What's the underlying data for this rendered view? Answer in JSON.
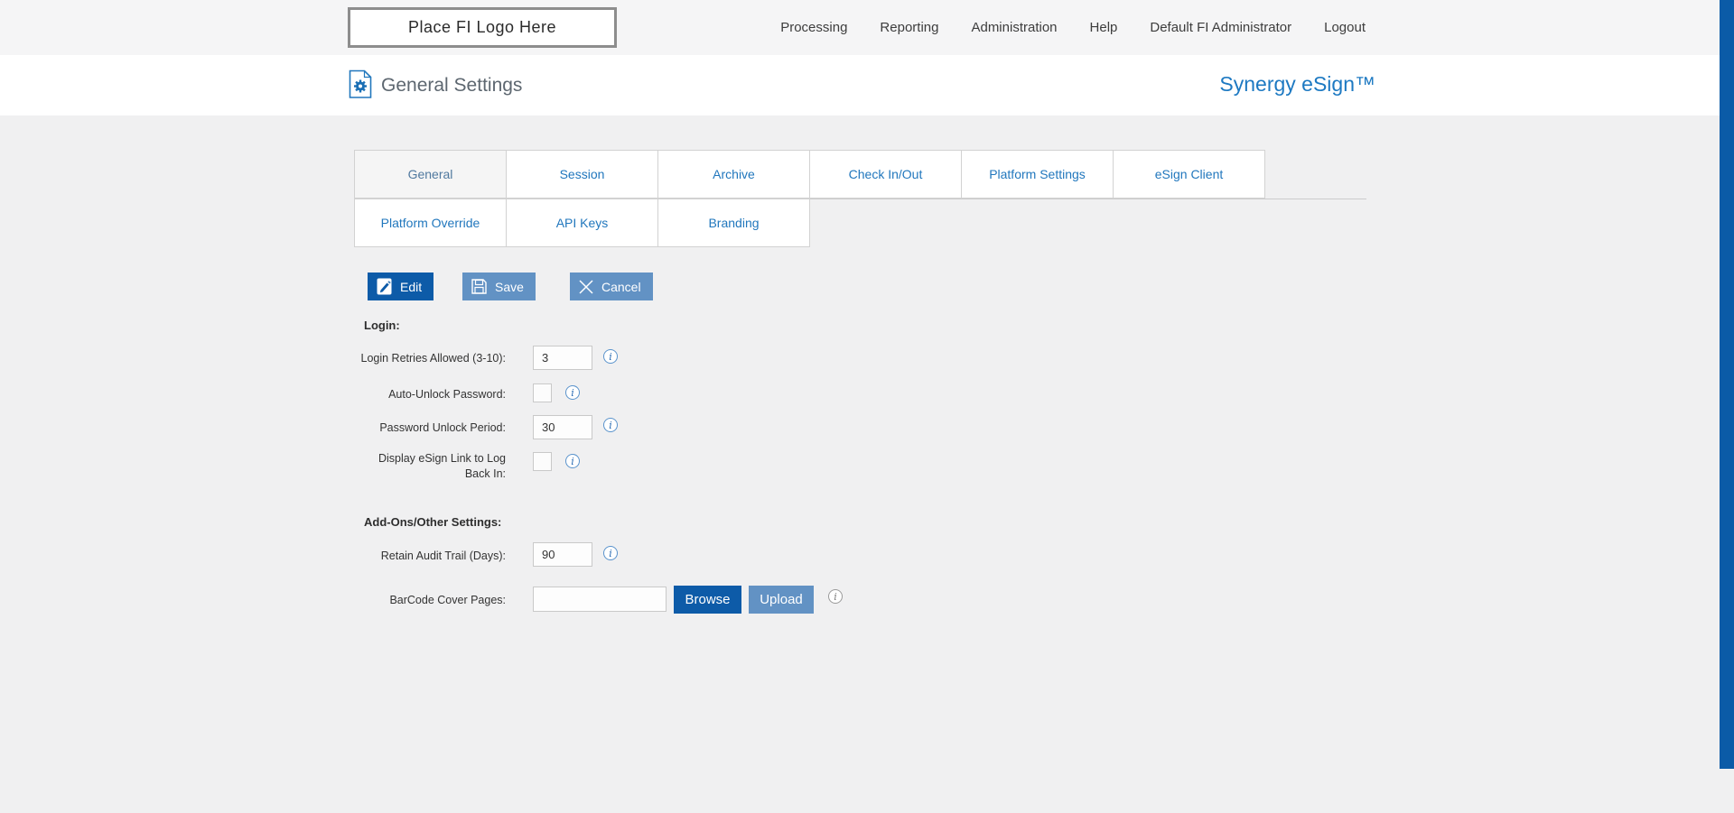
{
  "topbar": {
    "logo_placeholder": "Place FI Logo Here",
    "nav": [
      {
        "label": "Processing"
      },
      {
        "label": "Reporting"
      },
      {
        "label": "Administration"
      },
      {
        "label": "Help"
      },
      {
        "label": "Default FI Administrator"
      },
      {
        "label": "Logout"
      }
    ]
  },
  "header": {
    "title": "General Settings",
    "brand": "Synergy eSign™"
  },
  "tabs": {
    "active": "General",
    "row1": [
      "General",
      "Session",
      "Archive",
      "Check In/Out",
      "Platform Settings",
      "eSign Client"
    ],
    "row2": [
      "Platform Override",
      "API Keys",
      "Branding"
    ]
  },
  "toolbar": {
    "edit_label": "Edit",
    "save_label": "Save",
    "cancel_label": "Cancel"
  },
  "form": {
    "login_heading": "Login:",
    "login_retries": {
      "label": "Login Retries Allowed (3-10):",
      "value": "3"
    },
    "auto_unlock": {
      "label": "Auto-Unlock Password:",
      "checked": false
    },
    "unlock_period": {
      "label": "Password Unlock Period:",
      "value": "30"
    },
    "display_esign_link": {
      "label": "Display eSign Link to Log Back In:",
      "checked": false
    },
    "addons_heading": "Add-Ons/Other Settings:",
    "retain_audit": {
      "label": "Retain Audit Trail (Days):",
      "value": "90"
    },
    "barcode": {
      "label": "BarCode Cover Pages:",
      "value": "",
      "browse_label": "Browse",
      "upload_label": "Upload"
    }
  },
  "icons": {
    "info": "i",
    "title_icon": "settings-document",
    "edit_icon": "pencil-on-page",
    "save_icon": "floppy-disk",
    "cancel_icon": "x-mark"
  },
  "colors": {
    "accent_blue": "#2177bd",
    "brand_blue": "#1d79c2",
    "primary_button": "#0d5ba8",
    "muted_button": "#6292c4",
    "scrollbar_blue": "#0b5ba7",
    "page_background": "#f0f0f1",
    "topbar_background": "#f5f5f6"
  }
}
